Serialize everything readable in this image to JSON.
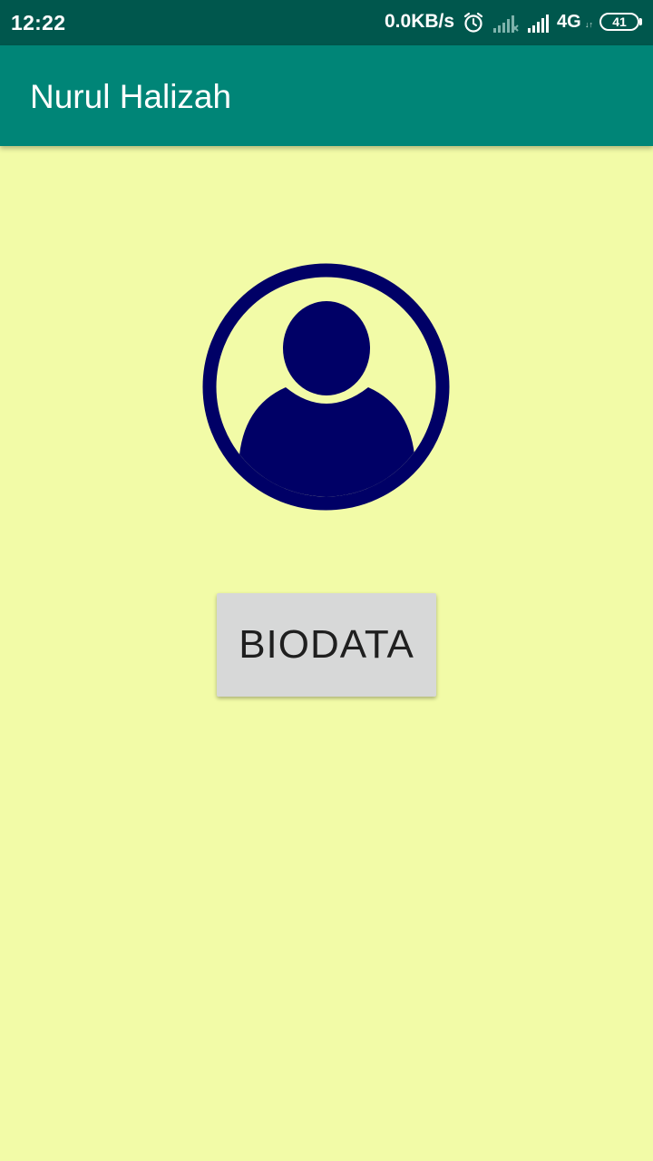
{
  "status_bar": {
    "time": "12:22",
    "speed": "0.0KB/s",
    "network_type": "4G",
    "network_arrows": "↓↑",
    "battery": "41",
    "icons": [
      "alarm-icon",
      "signal-icon",
      "signal-icon"
    ]
  },
  "app_bar": {
    "title": "Nurul Halizah"
  },
  "main": {
    "avatar_icon": "account-circle-icon",
    "button_label": "BIODATA"
  },
  "colors": {
    "status_bar": "#00574d",
    "app_bar": "#008577",
    "background": "#f2fba7",
    "avatar": "#000066",
    "button": "#d7d8d8"
  }
}
